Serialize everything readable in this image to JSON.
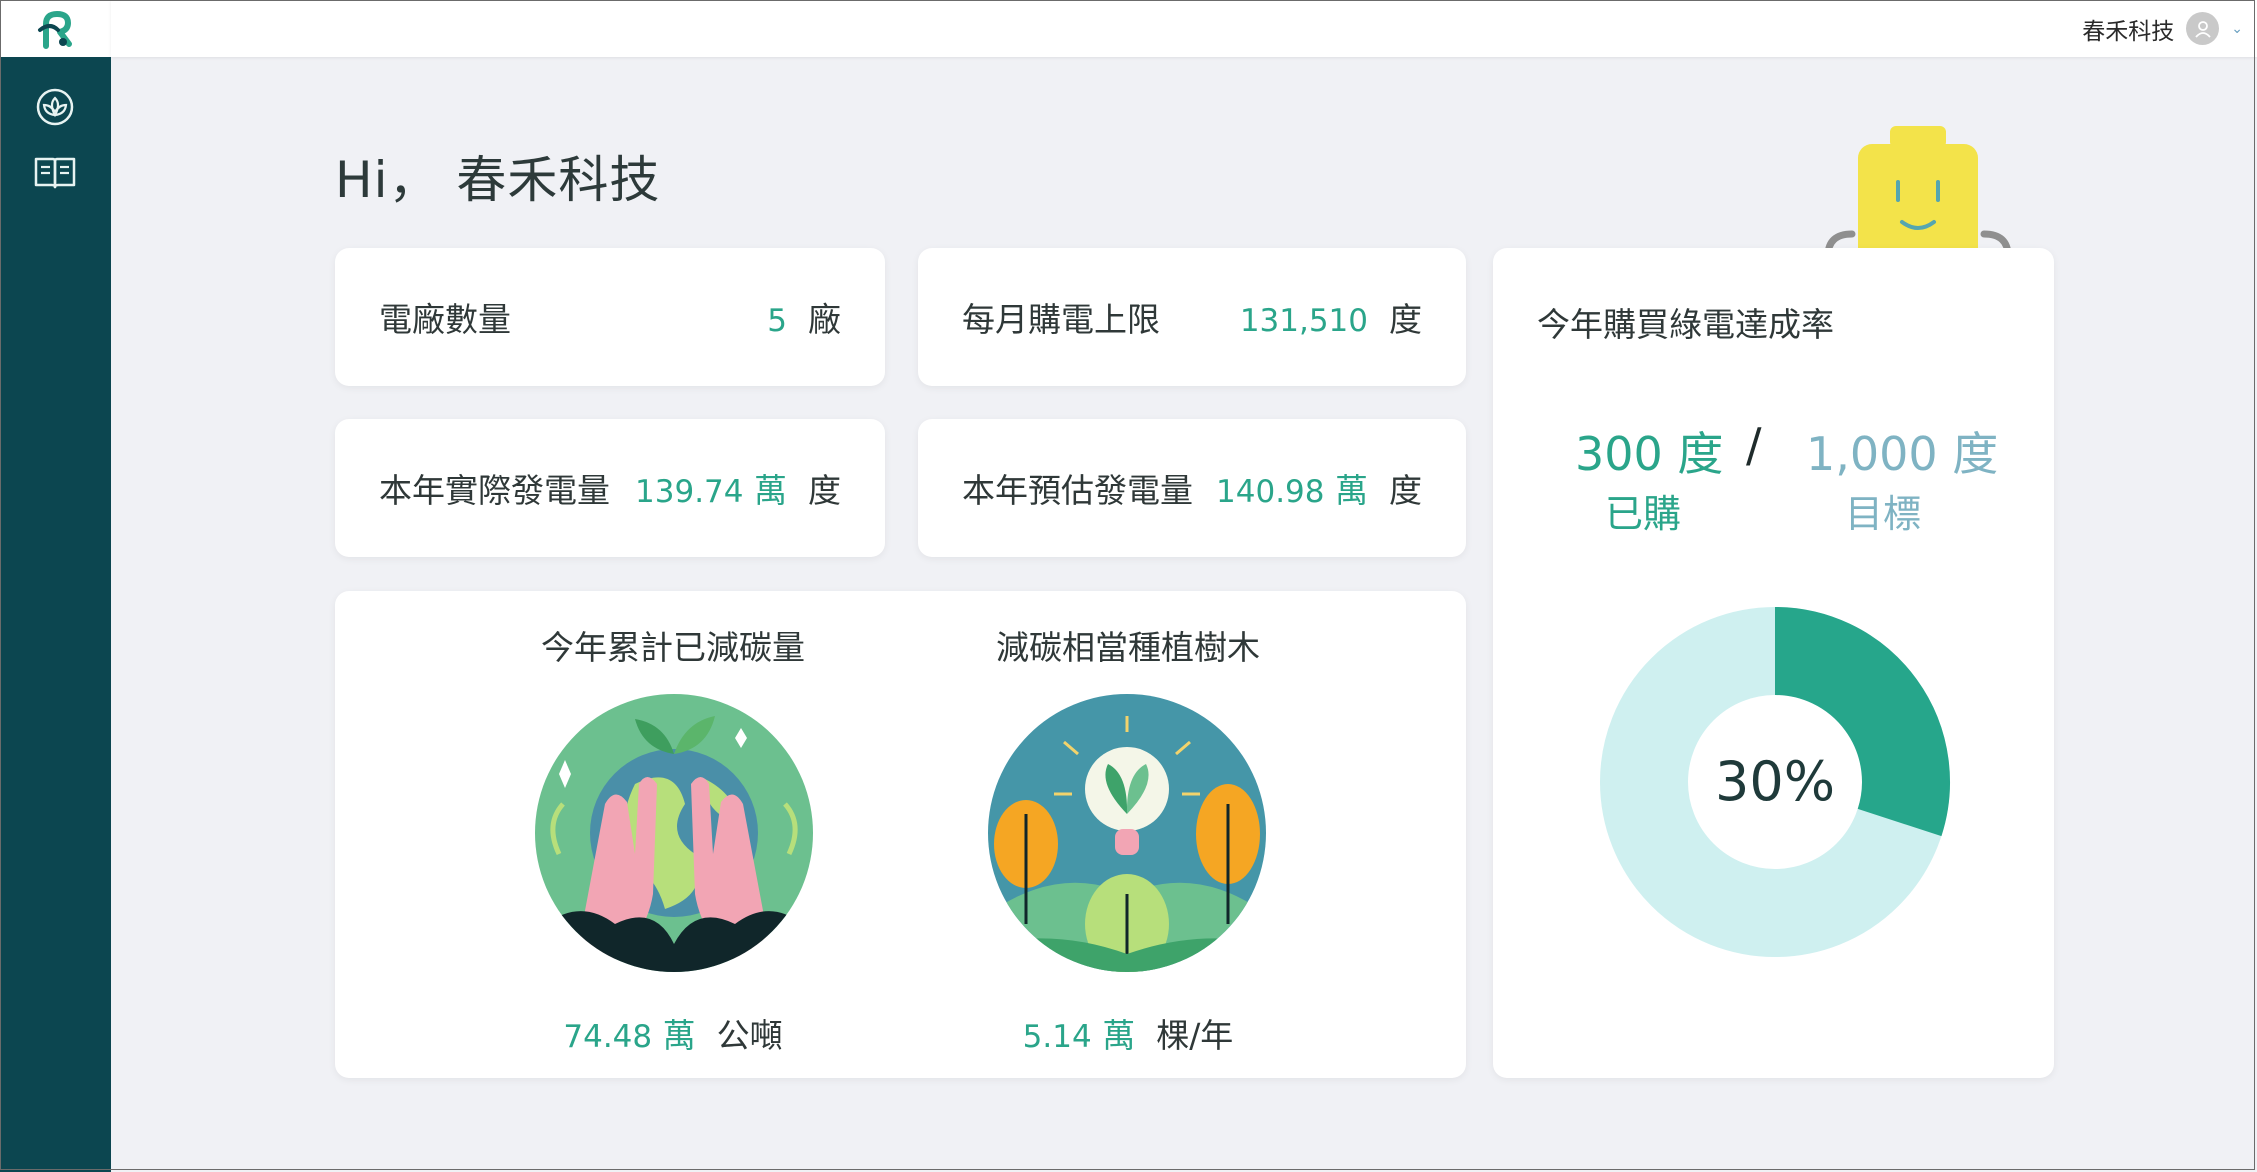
{
  "header": {
    "user_name": "春禾科技"
  },
  "sidebar": {
    "items": [
      {
        "icon": "lotus-icon"
      },
      {
        "icon": "book-icon"
      }
    ]
  },
  "greeting": "Hi， 春禾科技",
  "stats": {
    "plant_count": {
      "label": "電廠數量",
      "value": "5",
      "unit": "廠"
    },
    "monthly_limit": {
      "label": "每月購電上限",
      "value": "131,510",
      "unit": "度"
    },
    "actual_gen": {
      "label": "本年實際發電量",
      "value": "139.74",
      "scale": "萬",
      "unit": "度"
    },
    "estimated_gen": {
      "label": "本年預估發電量",
      "value": "140.98",
      "scale": "萬",
      "unit": "度"
    }
  },
  "carbon": {
    "reduced": {
      "title": "今年累計已減碳量",
      "value": "74.48",
      "scale": "萬",
      "unit": "公噸",
      "icon": "earth-hands-icon"
    },
    "trees": {
      "title": "減碳相當種植樹木",
      "value": "5.14",
      "scale": "萬",
      "unit": "棵/年",
      "icon": "lightbulb-plant-icon"
    }
  },
  "rate": {
    "title": "今年購買綠電達成率",
    "purchased": "300 度",
    "purchased_label": "已購",
    "separator": "/",
    "target": "1,000 度",
    "target_label": "目標",
    "percent_text": "30%",
    "percent": 0.3,
    "colors": {
      "done": "#26a68b",
      "remaining": "#cff0f0"
    }
  }
}
